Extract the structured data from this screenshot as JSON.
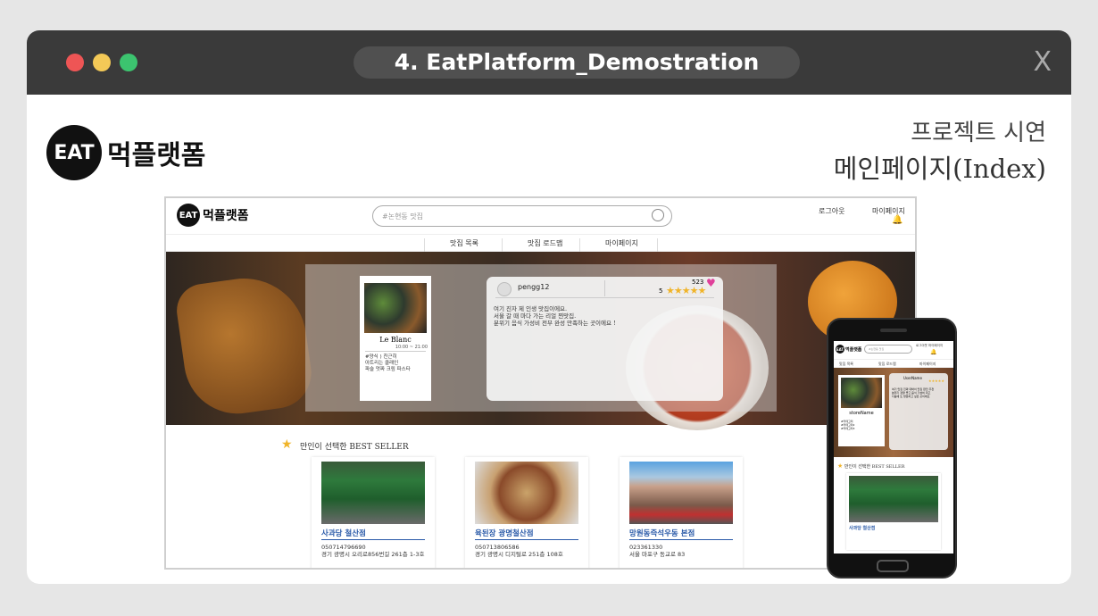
{
  "window": {
    "title": "4. EatPlatform_Demostration",
    "close": "X"
  },
  "brand": {
    "logo_mark": "EAT",
    "logo_text": "먹플랫폼"
  },
  "heading": {
    "line1": "프로젝트 시연",
    "line2": "메인페이지(Index)"
  },
  "site": {
    "search_placeholder": "#논현동 맛집",
    "login": "로그아웃",
    "mypage": "마이페이지",
    "nav": [
      "맛집 목록",
      "맛집 로드맵",
      "마이페이지"
    ],
    "featured": {
      "name": "Le Blanc",
      "hours": "10:00 ~ 21:00",
      "desc": "#양식 ) 친근히\n아트리는 클래인\n파슬 멋짜 크림 파스타"
    },
    "review": {
      "user": "pengg12",
      "likes": "523",
      "score": "5",
      "text": "여기 진자 제 인생 맛집이에요.\n서울 갈 때 마다 가는 리얼 찐맛집.\n분위기 음식 가성비 전부 완성 만족하는 곳이에요 !"
    },
    "bestseller_title": "만인이 선택한 BEST SELLER",
    "stores": [
      {
        "name": "사과당 철산점",
        "phone": "050714796690",
        "addr": "경기 광명시 오리로856번길 261층 1-3호"
      },
      {
        "name": "육된장 광명철산점",
        "phone": "050713806586",
        "addr": "경기 광명시 디지털로 251층 108호"
      },
      {
        "name": "망원동즉석우동 본점",
        "phone": "023361330",
        "addr": "서울 마포구 동교로 83"
      }
    ]
  },
  "mobile": {
    "logo_text": "먹플랫폼",
    "search_placeholder": "#논현동 맛집",
    "top_right": "로그아웃 마이페이지",
    "nav": [
      "맛집 목록",
      "맛집 로드맵",
      "마이페이지"
    ],
    "card_name": "storeName",
    "card_desc": "#카테고리\n#카테고리2\n#카테고리3",
    "review_user": "UserName",
    "review_text": "여기 맛집 진짜 대박이 맛집 완전 추천\n분위기 정말 좋고 음식 가성비 최고\n다음에 또 방문하고 싶은 곳이에요",
    "bestseller_title": "만인이 선택한 BEST SELLER",
    "store_name": "사과당 철산점"
  },
  "colors": {
    "accent_star": "#f0b429",
    "link_blue": "#2a5aa8",
    "heart": "#e0409a"
  }
}
